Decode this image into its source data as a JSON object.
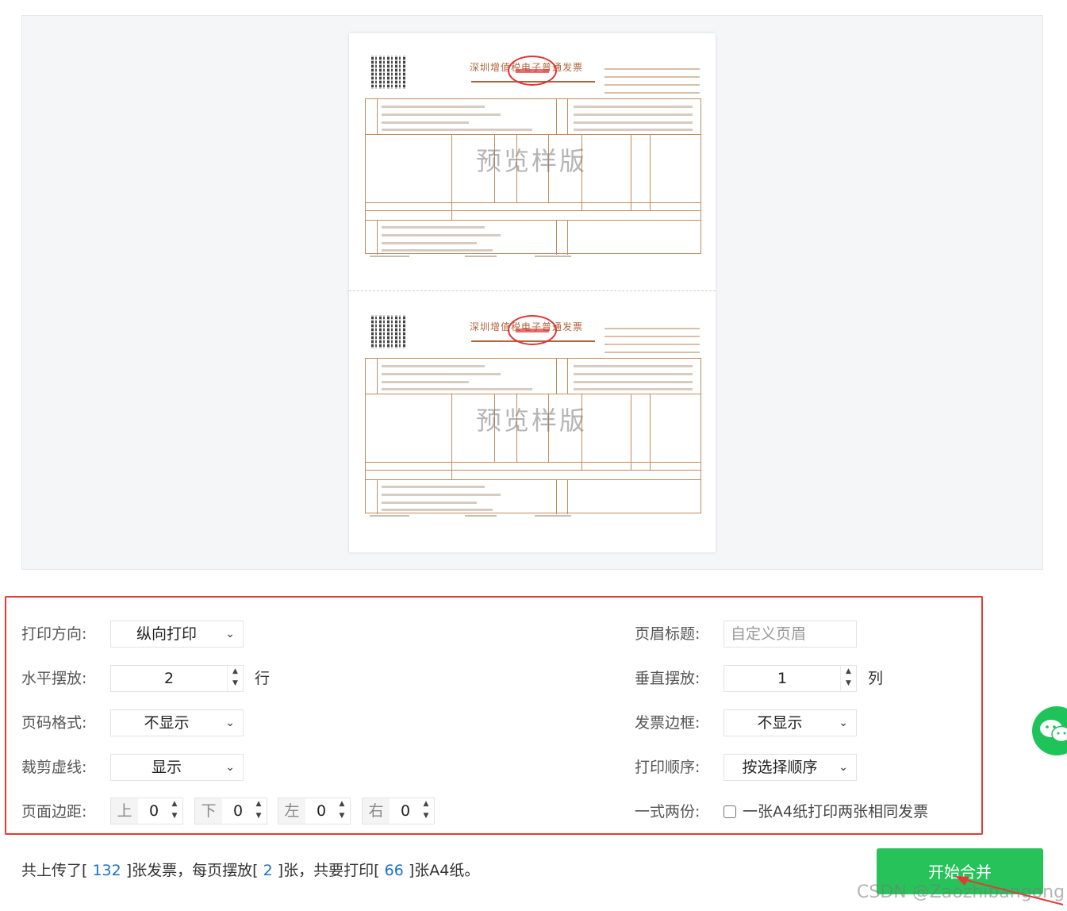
{
  "preview": {
    "invoice_title": "深圳增值税电子普通发票",
    "watermark": "预览样版"
  },
  "settings": {
    "print_direction": {
      "label": "打印方向:",
      "value": "纵向打印"
    },
    "horizontal": {
      "label": "水平摆放:",
      "value": "2",
      "unit": "行"
    },
    "page_number": {
      "label": "页码格式:",
      "value": "不显示"
    },
    "cut_line": {
      "label": "裁剪虚线:",
      "value": "显示"
    },
    "margins": {
      "label": "页面边距:",
      "top": {
        "tag": "上",
        "value": "0"
      },
      "bottom": {
        "tag": "下",
        "value": "0"
      },
      "left": {
        "tag": "左",
        "value": "0"
      },
      "right": {
        "tag": "右",
        "value": "0"
      }
    },
    "header_title": {
      "label": "页眉标题:",
      "placeholder": "自定义页眉"
    },
    "vertical": {
      "label": "垂直摆放:",
      "value": "1",
      "unit": "列"
    },
    "invoice_border": {
      "label": "发票边框:",
      "value": "不显示"
    },
    "print_order": {
      "label": "打印顺序:",
      "value": "按选择顺序"
    },
    "duplicate": {
      "label": "一式两份:",
      "text": "一张A4纸打印两张相同发票",
      "checked": false
    }
  },
  "summary": {
    "part1": "共上传了[ ",
    "uploaded": "132",
    "part2": " ]张发票，每页摆放[ ",
    "per_page": "2",
    "part3": " ]张，共要打印[ ",
    "sheets": "66",
    "part4": " ]张A4纸。"
  },
  "merge_button": "开始合并",
  "csdn_watermark": "CSDN @Zaozhibangong",
  "colors": {
    "accent_green": "#27c35a",
    "highlight_red": "#e53935",
    "number_blue": "#1a73c9"
  }
}
